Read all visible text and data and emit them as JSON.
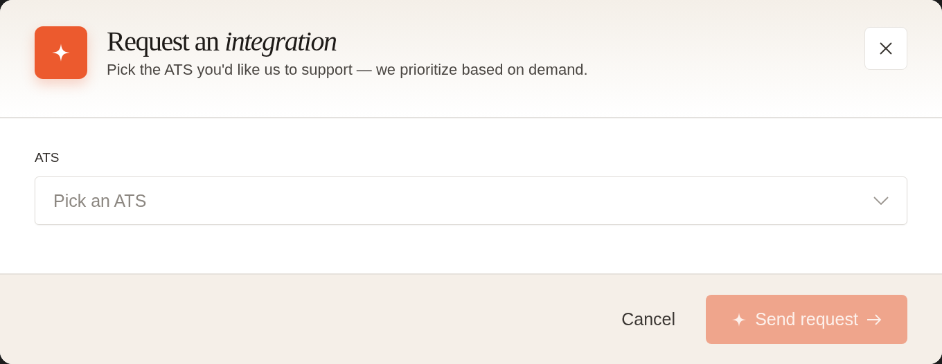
{
  "dialog": {
    "title": "Request an *integration*",
    "subtitle": "Pick the ATS you'd like us to support — we prioritize based on demand.",
    "field": {
      "label": "ATS",
      "placeholder": "Pick an ATS"
    },
    "buttons": [
      {
        "kind": "cancel",
        "label": "Cancel",
        "disabled": false
      },
      {
        "kind": "submit",
        "label": "Send request",
        "disabled": true
      }
    ]
  }
}
